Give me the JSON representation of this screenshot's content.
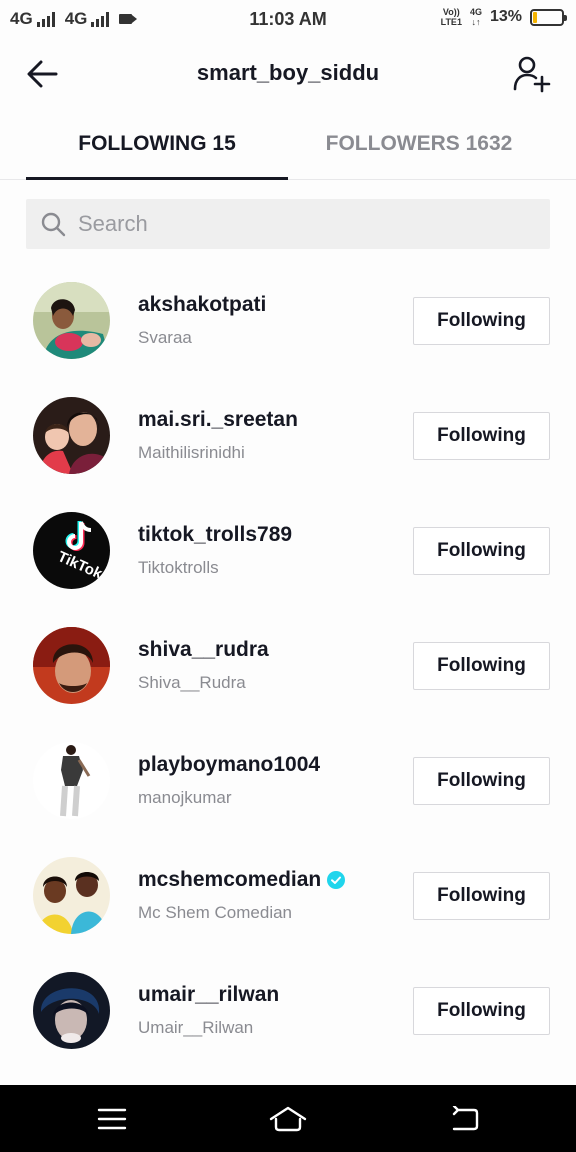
{
  "status_bar": {
    "network_1": "4G",
    "network_2": "4G",
    "time": "11:03 AM",
    "volte_top": "Vo))",
    "volte_bottom": "LTE1",
    "net_top": "4G",
    "net_bottom": "↓↑",
    "battery_percent": "13%",
    "battery_level": 0.13,
    "battery_color": "#f5b400"
  },
  "header": {
    "title": "smart_boy_siddu",
    "back_icon": "arrow-left-icon",
    "add_user_icon": "add-user-icon"
  },
  "tabs": [
    {
      "label": "FOLLOWING 15",
      "active": true
    },
    {
      "label": "FOLLOWERS 1632",
      "active": false
    }
  ],
  "search": {
    "placeholder": "Search",
    "value": ""
  },
  "users": [
    {
      "username": "akshakotpati",
      "nickname": "Svaraa",
      "button": "Following",
      "verified": false
    },
    {
      "username": "mai.sri._sreetan",
      "nickname": "Maithilisrinidhi",
      "button": "Following",
      "verified": false
    },
    {
      "username": "tiktok_trolls789",
      "nickname": "Tiktoktrolls",
      "button": "Following",
      "verified": false
    },
    {
      "username": "shiva__rudra",
      "nickname": "Shiva__Rudra",
      "button": "Following",
      "verified": false
    },
    {
      "username": "playboymano1004",
      "nickname": "manojkumar",
      "button": "Following",
      "verified": false
    },
    {
      "username": "mcshemcomedian",
      "nickname": "Mc Shem Comedian",
      "button": "Following",
      "verified": true
    },
    {
      "username": "umair__rilwan",
      "nickname": "Umair__Rilwan",
      "button": "Following",
      "verified": false
    }
  ],
  "avatar_logo_text": "TikTok",
  "colors": {
    "verified": "#20d5ec",
    "text_primary": "#161823",
    "text_secondary": "#8a8b91"
  },
  "navbar": {
    "menu_icon": "menu-icon",
    "home_icon": "home-icon",
    "back_icon": "back-nav-icon"
  }
}
